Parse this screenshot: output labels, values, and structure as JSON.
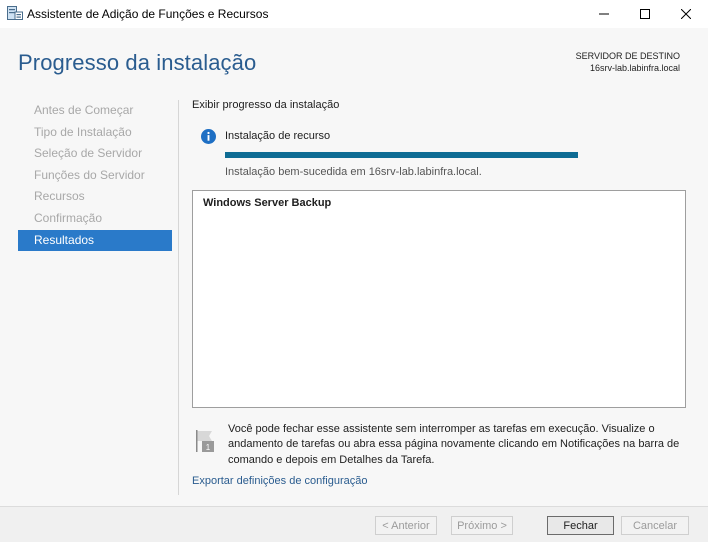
{
  "window": {
    "title": "Assistente de Adição de Funções e Recursos"
  },
  "header": {
    "page_title": "Progresso da instalação",
    "destination_label": "SERVIDOR DE DESTINO",
    "destination_server": "16srv-lab.labinfra.local"
  },
  "nav": {
    "items": [
      {
        "label": "Antes de Começar",
        "state": "disabled"
      },
      {
        "label": "Tipo de Instalação",
        "state": "disabled"
      },
      {
        "label": "Seleção de Servidor",
        "state": "disabled"
      },
      {
        "label": "Funções do Servidor",
        "state": "disabled"
      },
      {
        "label": "Recursos",
        "state": "disabled"
      },
      {
        "label": "Confirmação",
        "state": "disabled"
      },
      {
        "label": "Resultados",
        "state": "active"
      }
    ]
  },
  "main": {
    "section_label": "Exibir progresso da instalação",
    "feature_label": "Instalação de recurso",
    "progress_percent": 100,
    "status_text": "Instalação bem-sucedida em 16srv-lab.labinfra.local.",
    "results": [
      "Windows Server Backup"
    ],
    "notice": "Você pode fechar esse assistente sem interromper as tarefas em execução. Visualize o andamento de tarefas ou abra essa página novamente clicando em Notificações na barra de comando e depois em Detalhes da Tarefa.",
    "export_link": "Exportar definições de configuração"
  },
  "footer": {
    "previous": "< Anterior",
    "next": "Próximo >",
    "close": "Fechar",
    "cancel": "Cancelar"
  },
  "icons": {
    "app": "server-manager-icon",
    "info": "info-icon",
    "flag": "notification-flag-icon",
    "minimize": "minimize-icon",
    "maximize": "maximize-icon",
    "close": "close-icon"
  },
  "colors": {
    "accent": "#2a7ac9",
    "title": "#2a5c8f",
    "progress": "#0e6c94"
  }
}
